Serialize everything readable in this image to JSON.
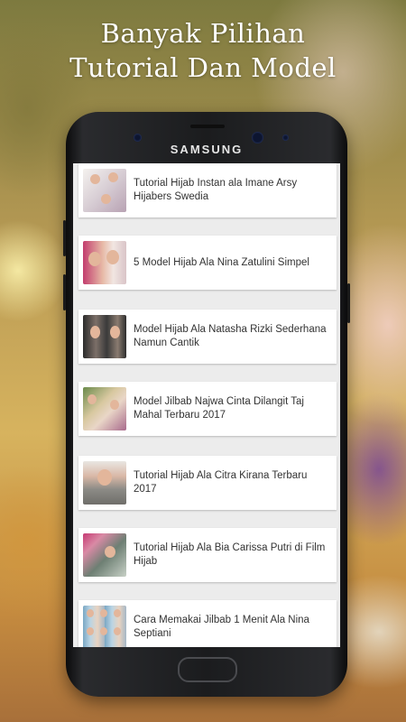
{
  "headline": {
    "line1": "Banyak Pilihan",
    "line2": "Tutorial Dan Model"
  },
  "phone": {
    "brand": "SAMSUNG"
  },
  "articles": [
    {
      "title": "Tutorial Hijab Instan ala Imane Arsy Hijabers Swedia"
    },
    {
      "title": "5 Model Hijab Ala Nina Zatulini Simpel"
    },
    {
      "title": "Model Hijab Ala Natasha Rizki Sederhana Namun Cantik"
    },
    {
      "title": "Model Jilbab Najwa Cinta Dilangit Taj Mahal Terbaru 2017"
    },
    {
      "title": "Tutorial Hijab Ala Citra Kirana Terbaru 2017"
    },
    {
      "title": "Tutorial Hijab Ala Bia Carissa Putri di Film Hijab"
    },
    {
      "title": "Cara Memakai Jilbab 1 Menit Ala Nina Septiani"
    }
  ]
}
